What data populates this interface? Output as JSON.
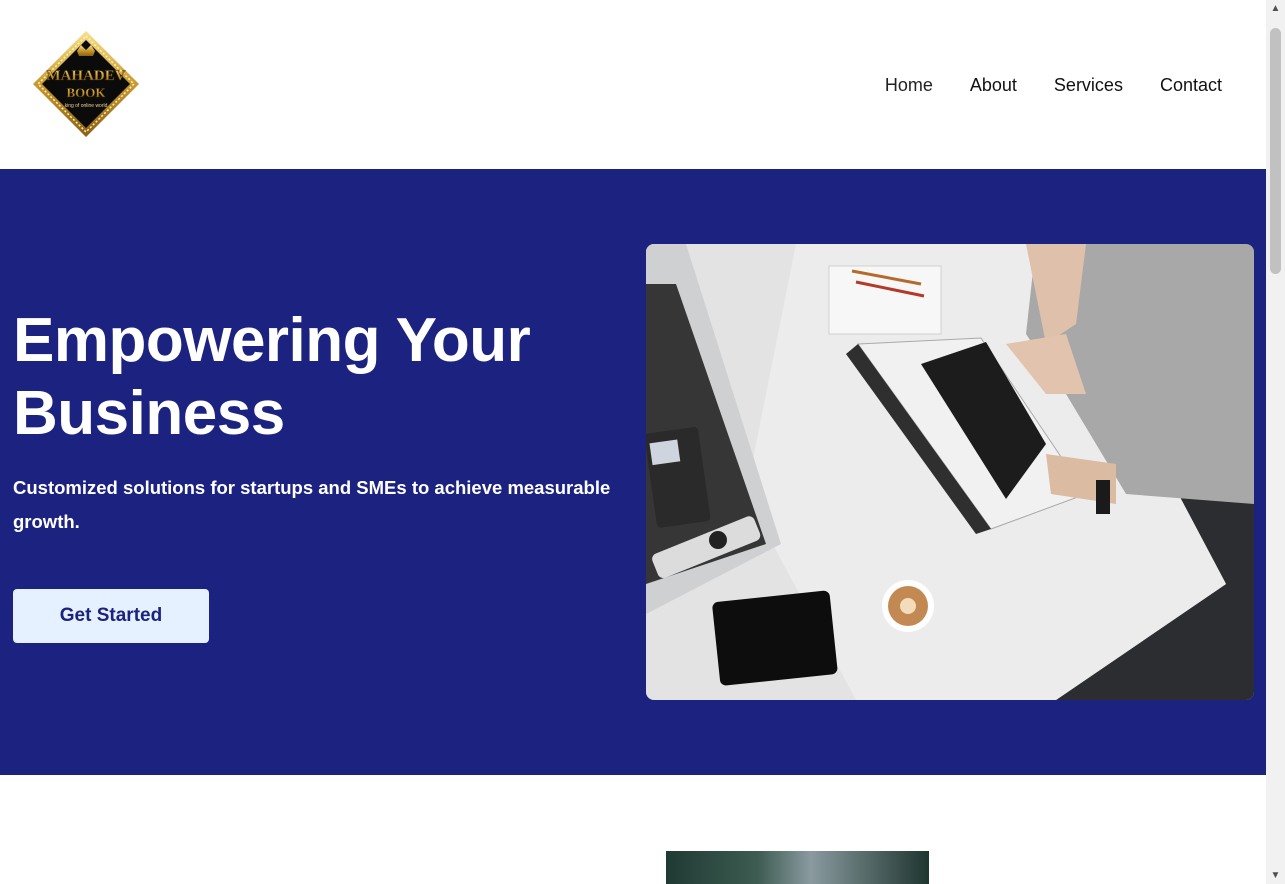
{
  "header": {
    "logo": {
      "name": "MAHADEV",
      "sub": "BOOK",
      "tagline": "king of online world"
    },
    "nav": [
      {
        "label": "Home"
      },
      {
        "label": "About"
      },
      {
        "label": "Services"
      },
      {
        "label": "Contact"
      }
    ]
  },
  "hero": {
    "title": "Empowering Your Business",
    "subtitle": "Customized solutions for startups and SMEs to achieve measurable growth.",
    "cta_label": "Get Started",
    "image_icon": "office-desk-laptop-photo"
  },
  "colors": {
    "hero_bg": "#1b2280",
    "cta_bg": "#e6f1ff",
    "cta_text": "#1b2280",
    "logo_gold": "#d4a63a"
  }
}
